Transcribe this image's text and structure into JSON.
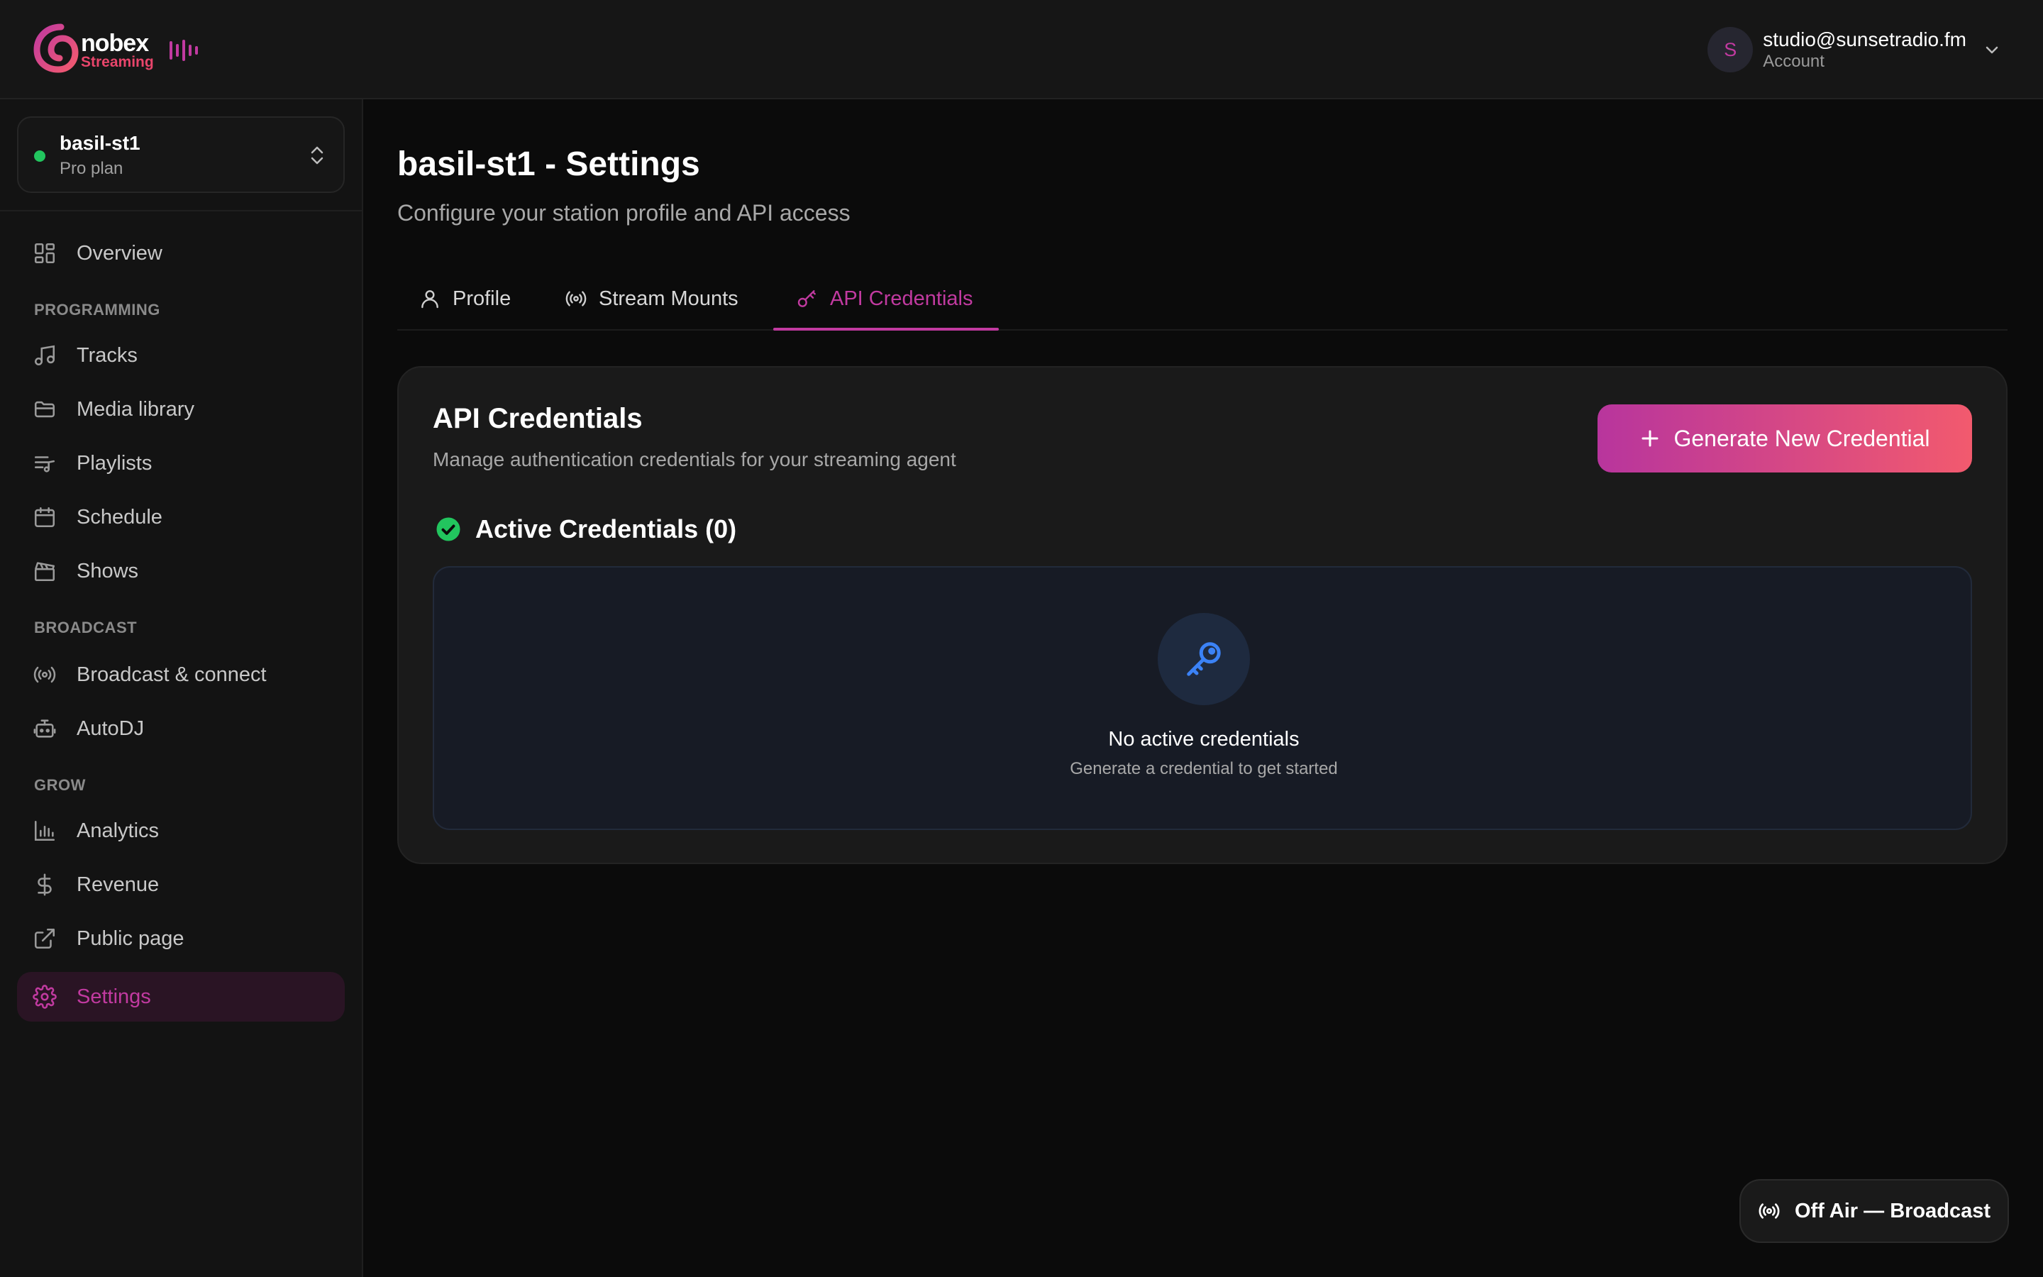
{
  "colors": {
    "accent": "#c13aa0",
    "accent_gradient_end": "#f25a6e",
    "status_online": "#22c55e",
    "key_icon": "#3b82f6"
  },
  "brand": {
    "name": "nobex",
    "tagline": "Streaming"
  },
  "account": {
    "initial": "S",
    "email": "studio@sunsetradio.fm",
    "label": "Account"
  },
  "station": {
    "name": "basil-st1",
    "plan": "Pro plan"
  },
  "sidebar": {
    "overview": {
      "label": "Overview",
      "icon": "dashboard-grid-icon"
    },
    "sections": {
      "programming": "PROGRAMMING",
      "broadcast": "BROADCAST",
      "grow": "GROW"
    },
    "programming_items": [
      {
        "label": "Tracks",
        "icon": "music-note-icon"
      },
      {
        "label": "Media library",
        "icon": "folder-icon"
      },
      {
        "label": "Playlists",
        "icon": "playlist-icon"
      },
      {
        "label": "Schedule",
        "icon": "calendar-icon"
      },
      {
        "label": "Shows",
        "icon": "clapperboard-icon"
      }
    ],
    "broadcast_items": [
      {
        "label": "Broadcast & connect",
        "icon": "radio-waves-icon"
      },
      {
        "label": "AutoDJ",
        "icon": "robot-icon"
      }
    ],
    "grow_items": [
      {
        "label": "Analytics",
        "icon": "bar-chart-icon"
      },
      {
        "label": "Revenue",
        "icon": "dollar-icon"
      },
      {
        "label": "Public page",
        "icon": "external-link-icon"
      },
      {
        "label": "Settings",
        "icon": "gear-icon",
        "active": true
      }
    ]
  },
  "page": {
    "title": "basil-st1 - Settings",
    "subtitle": "Configure your station profile and API access"
  },
  "tabs": [
    {
      "label": "Profile",
      "icon": "user-icon"
    },
    {
      "label": "Stream Mounts",
      "icon": "radio-waves-icon"
    },
    {
      "label": "API Credentials",
      "icon": "key-icon",
      "active": true
    }
  ],
  "credentials_card": {
    "title": "API Credentials",
    "description": "Manage authentication credentials for your streaming agent",
    "generate_button": "Generate New Credential",
    "active_heading": "Active Credentials (0)",
    "empty_title": "No active credentials",
    "empty_subtitle": "Generate a credential to get started"
  },
  "broadcast_status": {
    "label": "Off Air — Broadcast"
  }
}
